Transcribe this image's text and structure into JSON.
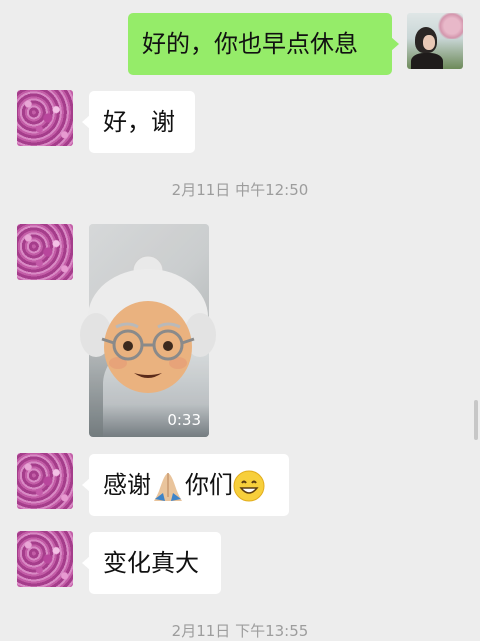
{
  "messages": {
    "m1": {
      "sender": "me",
      "text": "好的，你也早点休息"
    },
    "m2": {
      "sender": "other",
      "text": "好，谢"
    },
    "ts1": "2月11日 中午12:50",
    "m3": {
      "sender": "other",
      "type": "video",
      "duration": "0:33",
      "overlay_emoji": "older-woman-emoji"
    },
    "m4": {
      "sender": "other",
      "text_before": "感谢",
      "emoji_1": "folded-hands-emoji",
      "text_after": "你们",
      "emoji_2": "grinning-face-emoji"
    },
    "m5": {
      "sender": "other",
      "text": "变化真大"
    },
    "ts2": "2月11日 下午13:55"
  },
  "colors": {
    "background": "#ededed",
    "outgoing_bubble": "#95ec69",
    "incoming_bubble": "#ffffff",
    "timestamp_text": "#9d9d9d"
  }
}
